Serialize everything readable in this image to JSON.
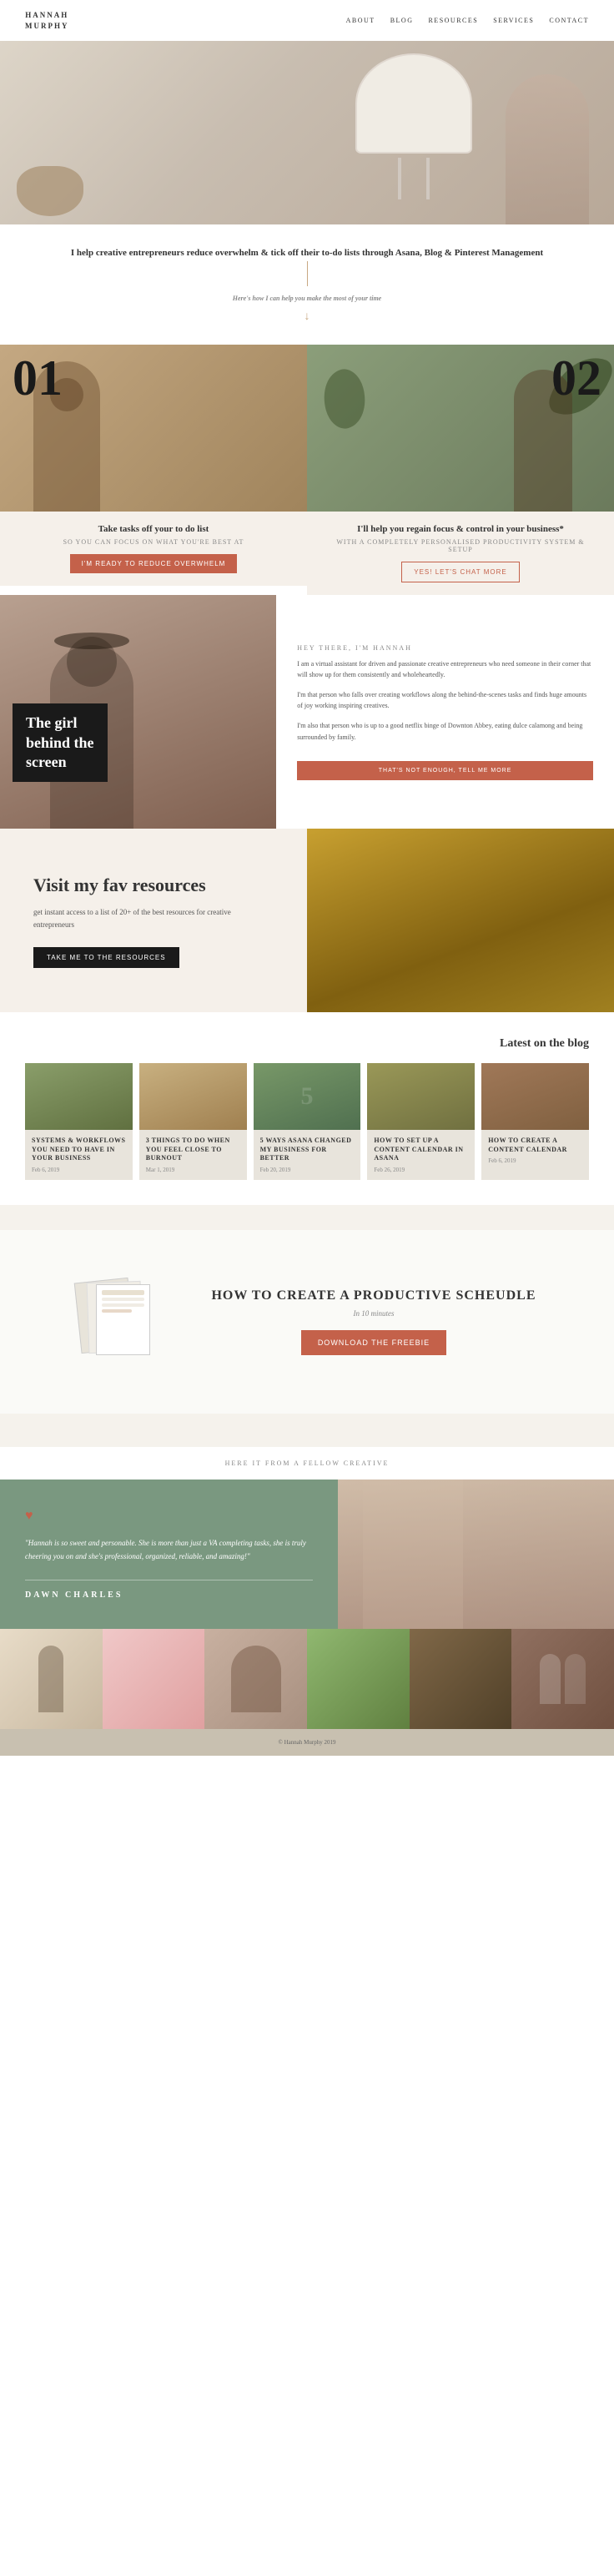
{
  "nav": {
    "logo_line1": "HANNAH",
    "logo_line2": "MURPHY",
    "links": [
      "ABOUT",
      "BLOG",
      "RESOURCES",
      "SERVICES",
      "CONTACT"
    ]
  },
  "tagline": {
    "text": "I help creative entrepreneurs reduce overwhelm & tick off their to-do lists through Asana, Blog & Pinterest Management",
    "subtext": "Here's how I can help you make the most of your time"
  },
  "service1": {
    "number": "01",
    "title": "Take tasks off your to do list",
    "subtitle": "SO YOU CAN FOCUS ON WHAT YOU'RE BEST AT",
    "button": "I'M READY TO REDUCE OVERWHELM"
  },
  "service2": {
    "number": "02",
    "title": "I'll help you regain focus & control in your business*",
    "subtitle": "WITH A COMPLETELY PERSONALISED PRODUCTIVITY SYSTEM & SETUP",
    "button": "YES! LET'S CHAT MORE"
  },
  "about": {
    "overlay_text": "The girl\nbehind the\nscreen",
    "hey_label": "HEY THERE, I'M HANNAH",
    "body1": "I am a virtual assistant for driven and passionate creative entrepreneurs who need someone in their corner that will show up for them consistently and wholeheartedly.",
    "body2": "I'm that person who falls over creating workflows along the behind-the-scenes tasks and finds huge amounts of joy working inspiring creatives.",
    "body3": "I'm also that person who is up to a good netflix binge of Downton Abbey, eating dulce calamong and being surrounded by family.",
    "button": "THAT'S NOT ENOUGH, TELL ME MORE"
  },
  "resources": {
    "title": "Visit my fav resources",
    "subtitle": "get instant access to a list of 20+ of the best resources for creative entrepreneurs",
    "button": "TAKE ME TO THE RESOURCES"
  },
  "blog": {
    "section_title": "Latest on the blog",
    "cards": [
      {
        "title": "SYSTEMS & WORKFLOWS YOU NEED TO HAVE IN YOUR BUSINESS",
        "date": "Feb 6, 2019",
        "color": "green"
      },
      {
        "title": "3 THINGS TO DO WHEN YOU FEEL CLOSE TO BURNOUT",
        "date": "Mar 1, 2019",
        "color": "tan"
      },
      {
        "title": "5 WAYS ASANA CHANGED MY BUSINESS FOR BETTER",
        "date": "Feb 20, 2019",
        "color": "sage"
      },
      {
        "title": "HOW TO SET UP A CONTENT CALENDAR IN ASANA",
        "date": "Feb 26, 2019",
        "color": "olive"
      },
      {
        "title": "HOW TO CREATE A CONTENT CALENDAR",
        "date": "Feb 6, 2019",
        "color": "highlight"
      }
    ]
  },
  "freebie": {
    "title": "HOW TO CREATE A PRODUCTIVE SCHEUDLE",
    "subtitle": "In 10 minutes",
    "button": "DOWNLOAD THE FREEBIE"
  },
  "testimonial": {
    "label": "HERE IT FROM A FELLOW CREATIVE",
    "quote": "\"Hannah is so sweet and personable. She is more than just a VA completing tasks, she is truly cheering you on and she's professional, organized, reliable, and amazing!\"",
    "name": "DAWN CHARLES"
  },
  "footer": {
    "copyright": "© Hannah Murphy 2019"
  },
  "colors": {
    "terracotta": "#c4614a",
    "dark": "#1a1a1a",
    "sage": "#7a9880",
    "tan": "#f5f0ea",
    "gold": "#c09030"
  }
}
